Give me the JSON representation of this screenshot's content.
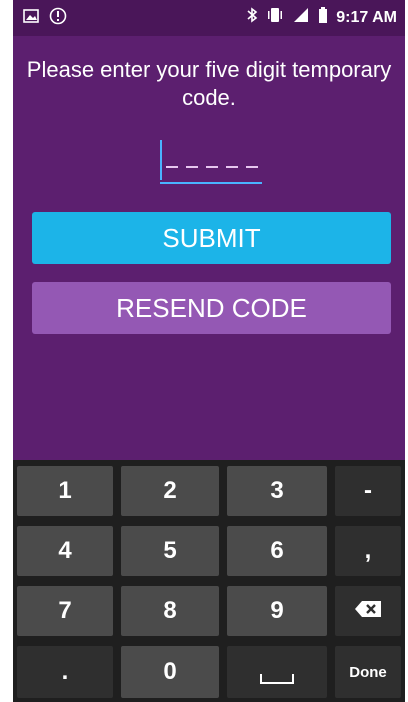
{
  "status_bar": {
    "time": "9:17 AM",
    "left_icons": [
      "image-icon",
      "alert-icon"
    ],
    "right_icons": [
      "bluetooth-icon",
      "vibrate-icon",
      "signal-icon",
      "battery-icon"
    ]
  },
  "screen": {
    "prompt": "Please enter your five digit temporary code.",
    "code_input": {
      "value": "",
      "placeholder_dashes": 5
    },
    "submit_label": "SUBMIT",
    "resend_label": "RESEND CODE"
  },
  "keyboard": {
    "rows": [
      [
        "1",
        "2",
        "3",
        "-"
      ],
      [
        "4",
        "5",
        "6",
        ","
      ],
      [
        "7",
        "8",
        "9",
        "backspace"
      ],
      [
        ".",
        "0",
        "space",
        "Done"
      ]
    ],
    "done_label": "Done"
  },
  "colors": {
    "background": "#5c1f6f",
    "submit": "#1cb4e8",
    "resend": "#9458b4",
    "keyboard": "#1f1f1f",
    "key": "#4b4b4b",
    "accent": "#4ab3ff"
  }
}
